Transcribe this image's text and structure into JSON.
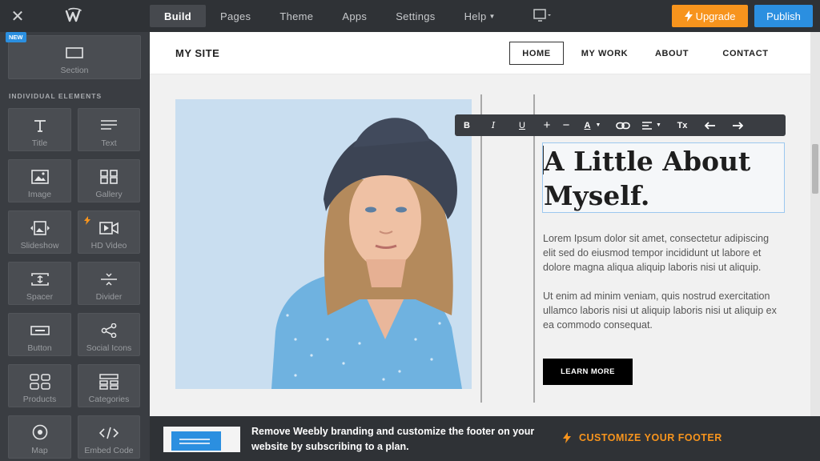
{
  "topbar": {
    "tabs": [
      {
        "label": "Build"
      },
      {
        "label": "Pages"
      },
      {
        "label": "Theme"
      },
      {
        "label": "Apps"
      },
      {
        "label": "Settings"
      },
      {
        "label": "Help"
      }
    ],
    "upgrade_label": "Upgrade",
    "publish_label": "Publish"
  },
  "sidebar": {
    "new_badge": "NEW",
    "section_label": "Section",
    "heading": "INDIVIDUAL ELEMENTS",
    "elements": [
      {
        "label": "Title",
        "icon": "title-icon"
      },
      {
        "label": "Text",
        "icon": "text-icon"
      },
      {
        "label": "Image",
        "icon": "image-icon"
      },
      {
        "label": "Gallery",
        "icon": "gallery-icon"
      },
      {
        "label": "Slideshow",
        "icon": "slideshow-icon"
      },
      {
        "label": "HD Video",
        "icon": "video-icon"
      },
      {
        "label": "Spacer",
        "icon": "spacer-icon"
      },
      {
        "label": "Divider",
        "icon": "divider-icon"
      },
      {
        "label": "Button",
        "icon": "button-icon"
      },
      {
        "label": "Social Icons",
        "icon": "share-icon"
      },
      {
        "label": "Products",
        "icon": "products-icon"
      },
      {
        "label": "Categories",
        "icon": "categories-icon"
      },
      {
        "label": "Map",
        "icon": "map-pin-icon"
      },
      {
        "label": "Embed Code",
        "icon": "code-icon"
      }
    ]
  },
  "site": {
    "title": "MY SITE",
    "nav": [
      {
        "label": "HOME"
      },
      {
        "label": "MY WORK"
      },
      {
        "label": "ABOUT"
      },
      {
        "label": "CONTACT"
      }
    ],
    "heading_line1": "A Little About",
    "heading_line2": "Myself.",
    "para1": "Lorem Ipsum dolor sit amet, consectetur adipiscing elit sed do eiusmod tempor incididunt ut labore et dolore magna aliqua aliquip laboris nisi ut aliquip.",
    "para2": "Ut enim ad minim veniam, quis nostrud exercitation ullamco laboris nisi ut aliquip laboris nisi ut aliquip ex ea commodo consequat.",
    "button_label": "LEARN MORE"
  },
  "toolbar": {
    "bold": "B",
    "italic": "I",
    "underline": "U",
    "increase": "+",
    "decrease": "−",
    "color": "A",
    "clear": "Tx"
  },
  "footer": {
    "message": "Remove Weebly branding and customize the footer on your website by subscribing to a plan.",
    "cta": "CUSTOMIZE YOUR FOOTER"
  },
  "colors": {
    "accent_orange": "#f7941d",
    "accent_blue": "#2b8fe0"
  }
}
